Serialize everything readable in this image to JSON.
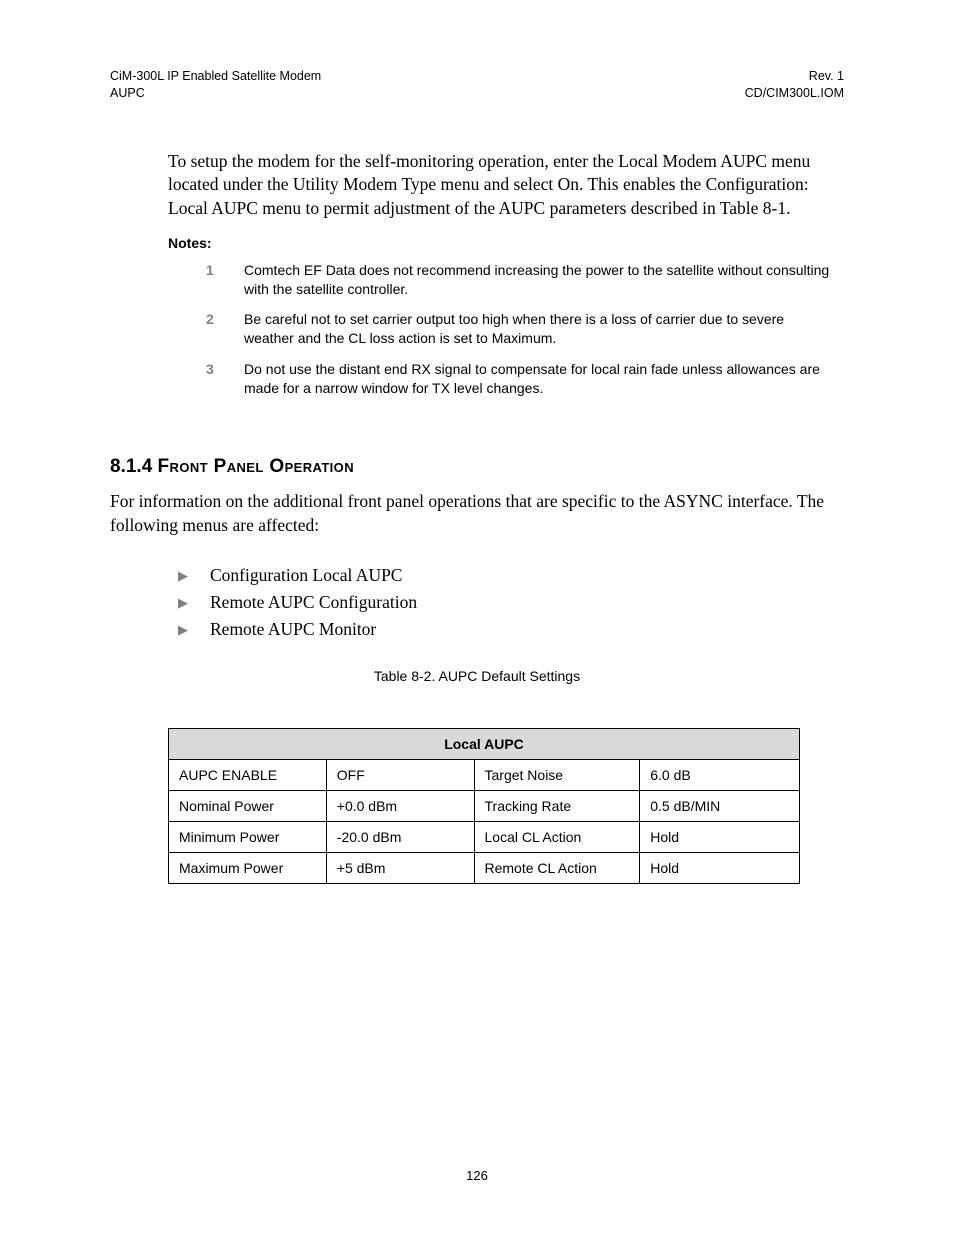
{
  "header": {
    "left_line1": "CiM-300L IP Enabled Satellite Modem",
    "left_line2": "AUPC",
    "right_line1": "Rev. 1",
    "right_line2": "CD/CIM300L.IOM"
  },
  "intro_paragraph": "To setup the modem for the self-monitoring operation, enter the Local Modem AUPC menu located under the Utility Modem Type menu and select On. This enables the Configuration: Local AUPC menu to permit adjustment of the AUPC parameters described in Table 8-1.",
  "notes_heading": "Notes:",
  "notes": [
    {
      "num": "1",
      "text": "Comtech EF Data does not recommend increasing the power to the satellite without consulting with the satellite controller."
    },
    {
      "num": "2",
      "text": "Be careful not to set carrier output too high when there is a loss of carrier due to severe weather and the CL loss action is set to Maximum."
    },
    {
      "num": "3",
      "text": "Do not use the distant end RX signal to compensate for local rain fade unless allowances are made for a narrow window for TX level changes."
    }
  ],
  "section": {
    "number": "8.1.4",
    "title": "Front Panel Operation"
  },
  "section_intro": "For information on the additional front panel operations that are specific to the ASYNC interface. The following menus are affected:",
  "bullets": [
    "Configuration Local AUPC",
    "Remote AUPC Configuration",
    "Remote AUPC Monitor"
  ],
  "table": {
    "caption": "Table 8-2.  AUPC Default Settings",
    "title": "Local AUPC",
    "rows": [
      {
        "c1": "AUPC ENABLE",
        "c2": "OFF",
        "c3": "Target Noise",
        "c4": "6.0 dB"
      },
      {
        "c1": "Nominal Power",
        "c2": "+0.0 dBm",
        "c3": "Tracking Rate",
        "c4": "0.5 dB/MIN"
      },
      {
        "c1": "Minimum Power",
        "c2": "-20.0 dBm",
        "c3": "Local CL Action",
        "c4": "Hold"
      },
      {
        "c1": "Maximum Power",
        "c2": "+5 dBm",
        "c3": "Remote CL Action",
        "c4": "Hold"
      }
    ]
  },
  "page_number": "126"
}
